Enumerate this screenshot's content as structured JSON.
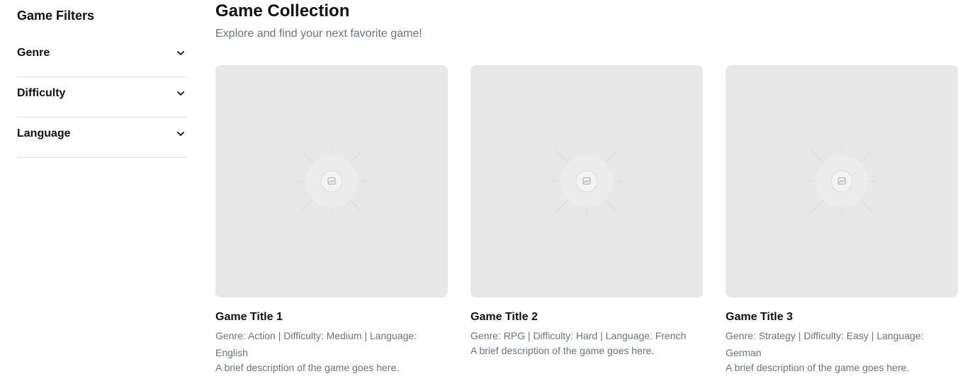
{
  "sidebar": {
    "title": "Game Filters",
    "filters": [
      {
        "label": "Genre"
      },
      {
        "label": "Difficulty"
      },
      {
        "label": "Language"
      }
    ]
  },
  "main": {
    "title": "Game Collection",
    "subtitle": "Explore and find your next favorite game!",
    "cards": [
      {
        "title": "Game Title 1",
        "meta": "Genre: Action | Difficulty: Medium | Language: English",
        "description": "A brief description of the game goes here."
      },
      {
        "title": "Game Title 2",
        "meta": "Genre: RPG | Difficulty: Hard | Language: French",
        "description": "A brief description of the game goes here."
      },
      {
        "title": "Game Title 3",
        "meta": "Genre: Strategy | Difficulty: Easy | Language: German",
        "description": "A brief description of the game goes here."
      }
    ]
  },
  "icons": {
    "filter_toggle": "chevron-down-icon",
    "card_image": "image-placeholder-icon"
  },
  "colors": {
    "text_primary": "#111111",
    "text_muted": "#6b7280",
    "placeholder_bg": "#e8e8e8",
    "divider": "#e5e5e5"
  }
}
